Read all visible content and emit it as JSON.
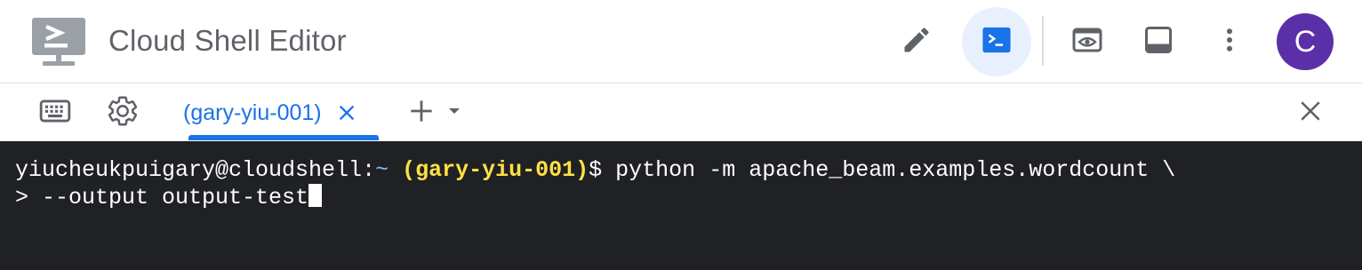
{
  "header": {
    "title": "Cloud Shell Editor",
    "avatar_initial": "C",
    "buttons": {
      "edit_icon": "pencil-icon",
      "terminal_icon": "terminal-icon",
      "preview_icon": "web-preview-icon",
      "panel_icon": "bottom-panel-icon",
      "more_icon": "more-vert-icon"
    }
  },
  "tabbar": {
    "active_tab": "(gary-yiu-001)",
    "close_icon": "close-icon"
  },
  "terminal": {
    "prompt_user": "yiucheukpuigary@cloudshell:",
    "prompt_path": "~",
    "prompt_project": "(gary-yiu-001)",
    "prompt_symbol": "$ ",
    "line1_command": "python -m apache_beam.examples.wordcount \\",
    "line2_prompt": "> ",
    "line2_command": "--output output-test"
  },
  "colors": {
    "accent": "#1a73e8",
    "terminal_bg": "#202124",
    "project_color": "#fde047",
    "avatar_bg": "#5b2fa8"
  }
}
